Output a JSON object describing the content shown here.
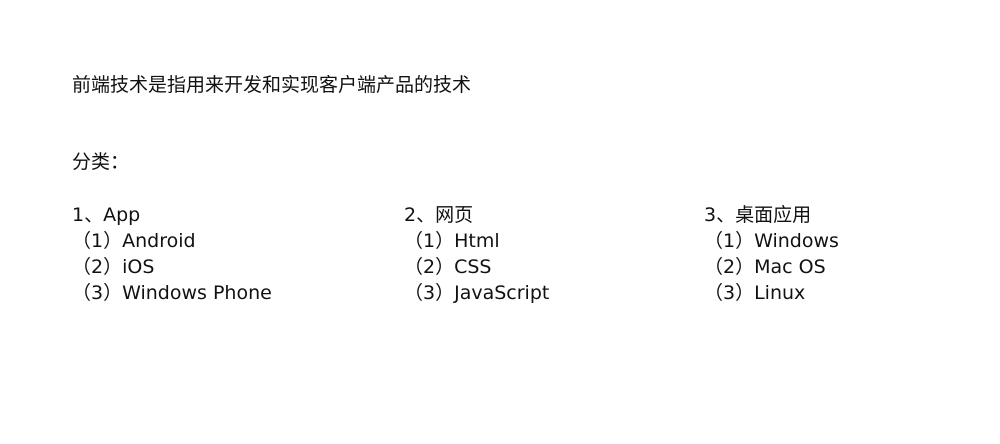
{
  "headline": "前端技术是指用来开发和实现客户端产品的技术",
  "section_label": "分类：",
  "categories": [
    {
      "title": "1、App",
      "items": [
        "（1）Android",
        "（2）iOS",
        "（3）Windows Phone"
      ]
    },
    {
      "title": "2、网页",
      "items": [
        "（1）Html",
        "（2）CSS",
        "（3）JavaScript"
      ]
    },
    {
      "title": "3、桌面应用",
      "items": [
        "（1）Windows",
        "（2）Mac OS",
        "（3）Linux"
      ]
    }
  ]
}
